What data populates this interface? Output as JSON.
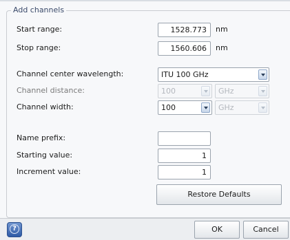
{
  "group": {
    "title": "Add channels"
  },
  "fields": {
    "start_range": {
      "label": "Start range:",
      "value": "1528.773",
      "unit": "nm"
    },
    "stop_range": {
      "label": "Stop range:",
      "value": "1560.606",
      "unit": "nm"
    },
    "center_wavelength": {
      "label": "Channel center wavelength:",
      "value": "ITU 100 GHz"
    },
    "channel_distance": {
      "label": "Channel distance:",
      "value": "100",
      "unit_value": "GHz"
    },
    "channel_width": {
      "label": "Channel width:",
      "value": "100",
      "unit_value": "GHz"
    },
    "name_prefix": {
      "label": "Name prefix:",
      "value": ""
    },
    "starting_value": {
      "label": "Starting value:",
      "value": "1"
    },
    "increment_value": {
      "label": "Increment value:",
      "value": "1"
    }
  },
  "buttons": {
    "restore_defaults": "Restore Defaults",
    "ok": "OK",
    "cancel": "Cancel"
  },
  "icons": {
    "help": "help-icon"
  },
  "colors": {
    "accent": "#2e5aa6",
    "legend_text": "#3a4a6a"
  }
}
